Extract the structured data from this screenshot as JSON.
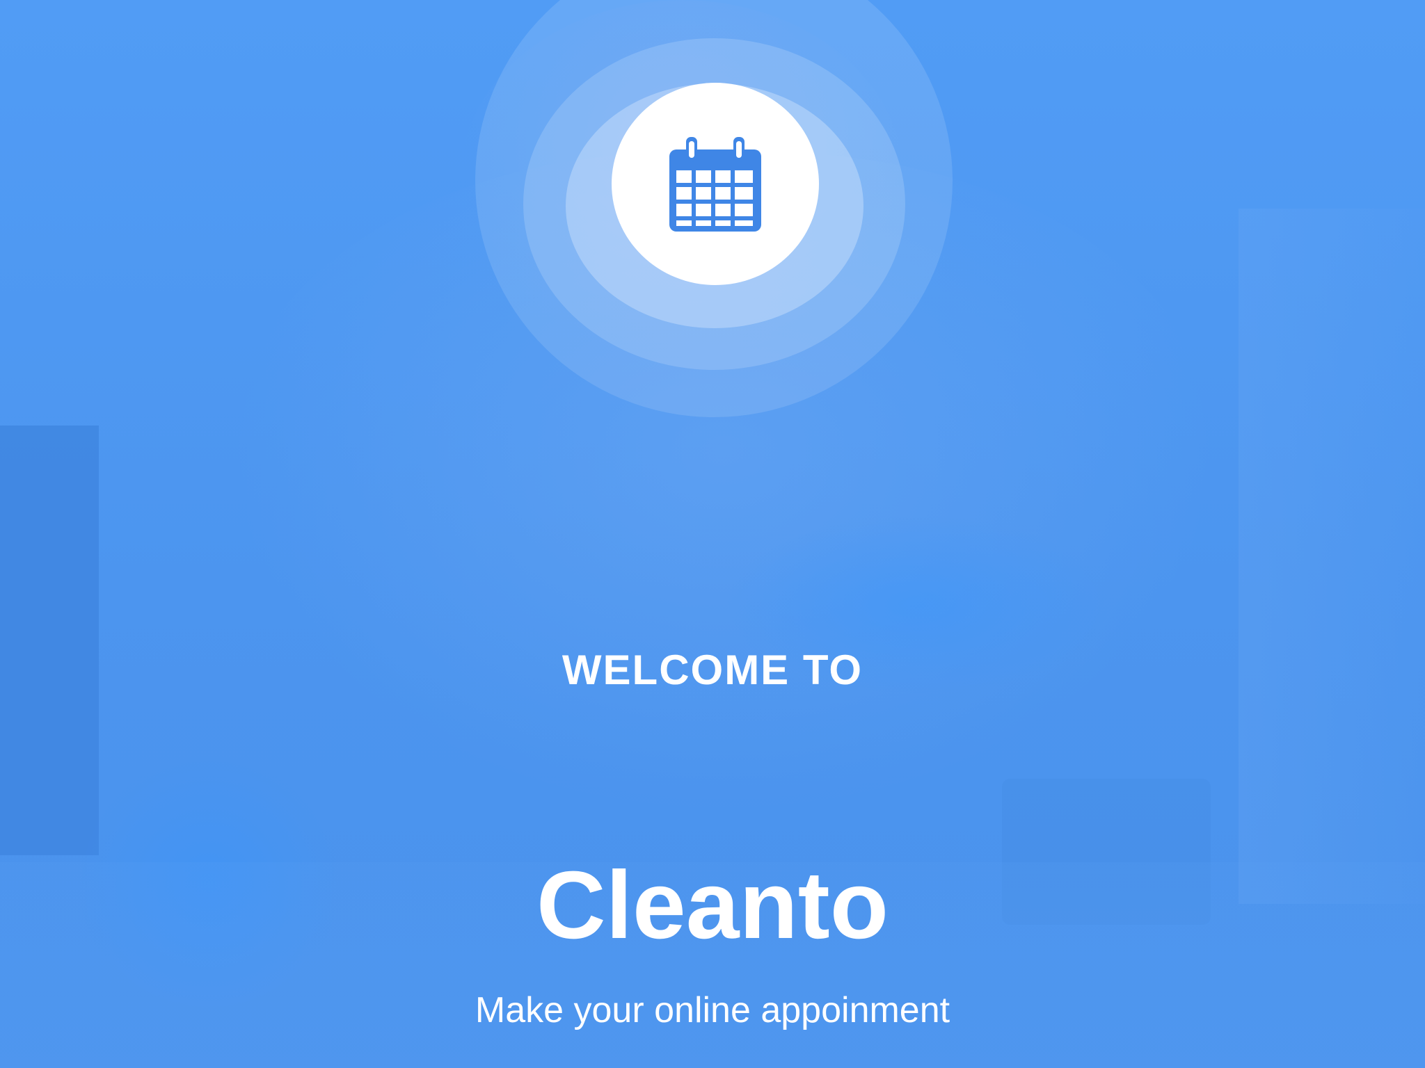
{
  "splash": {
    "welcome_text": "WELCOME TO",
    "brand_name": "Cleanto",
    "tagline": "Make your online appoinment",
    "icon": "calendar-icon"
  },
  "colors": {
    "background": "#4f98f1",
    "icon_accent": "#3f86e6",
    "text": "#ffffff"
  }
}
